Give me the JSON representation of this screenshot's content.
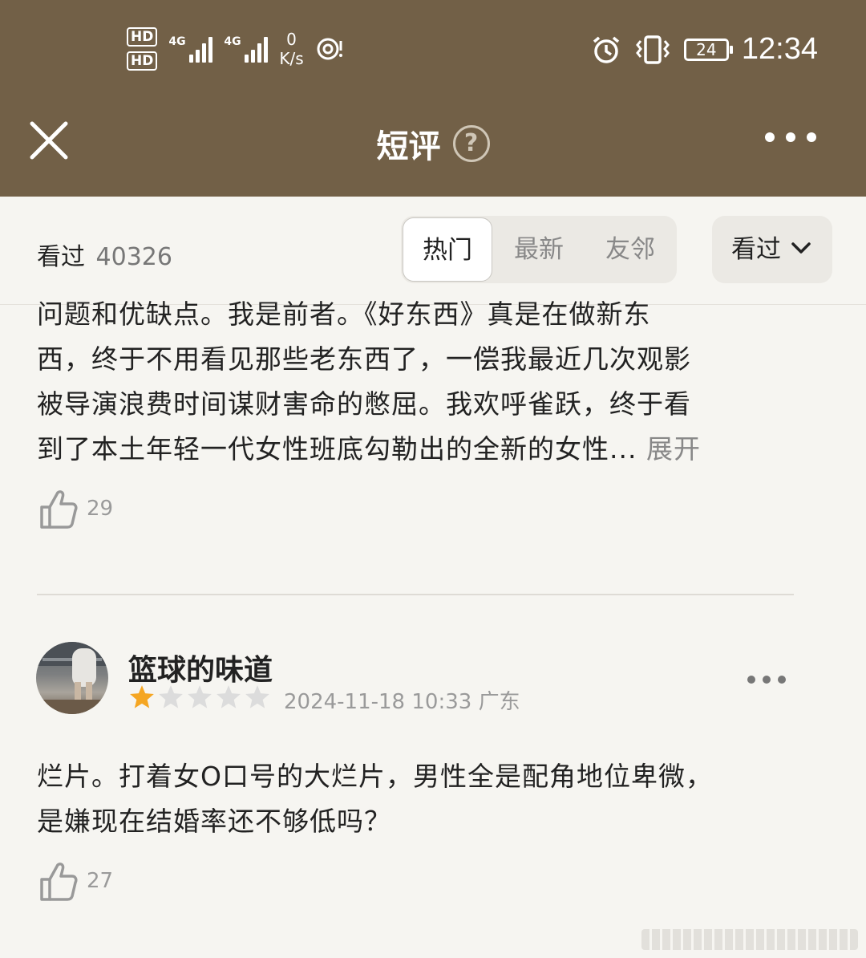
{
  "status_bar": {
    "sim1": "HD",
    "sim2": "HD",
    "sig1_label": "4G",
    "sig2_label": "4G",
    "net_speed_value": "0",
    "net_speed_unit": "K/s",
    "battery": "24",
    "time": "12:34",
    "icons": [
      "hd-icon",
      "signal-icon",
      "nfc-icon",
      "alarm-icon",
      "vibrate-icon",
      "battery-icon"
    ]
  },
  "header": {
    "title": "短评",
    "help_symbol": "?",
    "icons": [
      "close-icon",
      "help-icon",
      "more-icon"
    ]
  },
  "filter_bar": {
    "seen_label": "看过",
    "seen_count": "40326",
    "tabs": [
      "热门",
      "最新",
      "友邻"
    ],
    "active_tab": "热门",
    "seen_filter": "看过",
    "colors": {
      "header_bg": "#726047",
      "page_bg": "#f6f5f1"
    }
  },
  "reviews": [
    {
      "text_lines": [
        "问题和优缺点。我是前者。《好东西》真是在做新东",
        "西，终于不用看见那些老东西了，一偿我最近几次观影",
        "被导演浪费时间谋财害命的憋屈。我欢呼雀跃，终于看"
      ],
      "last_line": "到了本土年轻一代女性班底勾勒出的全新的女性...",
      "expand_label": "展开",
      "likes": "29"
    },
    {
      "username": "篮球的味道",
      "rating": 1,
      "rating_max": 5,
      "datetime": "2024-11-18 10:33",
      "location": "广东",
      "text_lines": [
        "烂片。打着女O口号的大烂片，男性全是配角地位卑微，",
        "是嫌现在结婚率还不够低吗？"
      ],
      "likes": "27",
      "star_color_on": "#f5a623",
      "star_color_off": "#dcdcdc"
    }
  ]
}
